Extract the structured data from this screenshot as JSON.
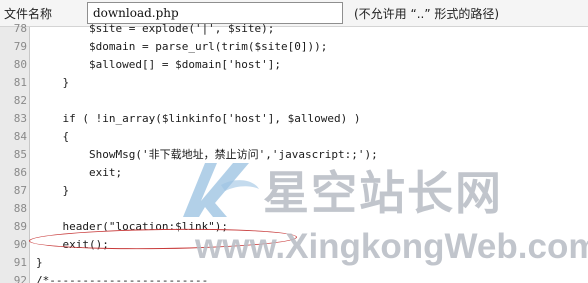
{
  "file_bar": {
    "label": "文件名称",
    "filename_value": "download.php",
    "hint": "(不允许用 “..” 形式的路径)"
  },
  "editor": {
    "lines": [
      {
        "num": "78",
        "code": "        $site = explode('|', $site);"
      },
      {
        "num": "79",
        "code": "        $domain = parse_url(trim($site[0]));"
      },
      {
        "num": "80",
        "code": "        $allowed[] = $domain['host'];"
      },
      {
        "num": "81",
        "code": "    }"
      },
      {
        "num": "82",
        "code": ""
      },
      {
        "num": "83",
        "code": "    if ( !in_array($linkinfo['host'], $allowed) )"
      },
      {
        "num": "84",
        "code": "    {"
      },
      {
        "num": "85",
        "code": "        ShowMsg('非下载地址，禁止访问','javascript:;');"
      },
      {
        "num": "86",
        "code": "        exit;"
      },
      {
        "num": "87",
        "code": "    }"
      },
      {
        "num": "88",
        "code": ""
      },
      {
        "num": "89",
        "code": "    header(\"location:$link\");"
      },
      {
        "num": "90",
        "code": "    exit();"
      },
      {
        "num": "91",
        "code": "}"
      },
      {
        "num": "92",
        "code": "/*------------------------"
      }
    ]
  },
  "annotation": {
    "highlight_color": "#c83a3a",
    "highlighted_line": "89"
  },
  "watermark": {
    "chinese_text": "星空站长网",
    "url_text": "www.XingkongWeb.com",
    "color": "#b7bcc4"
  }
}
